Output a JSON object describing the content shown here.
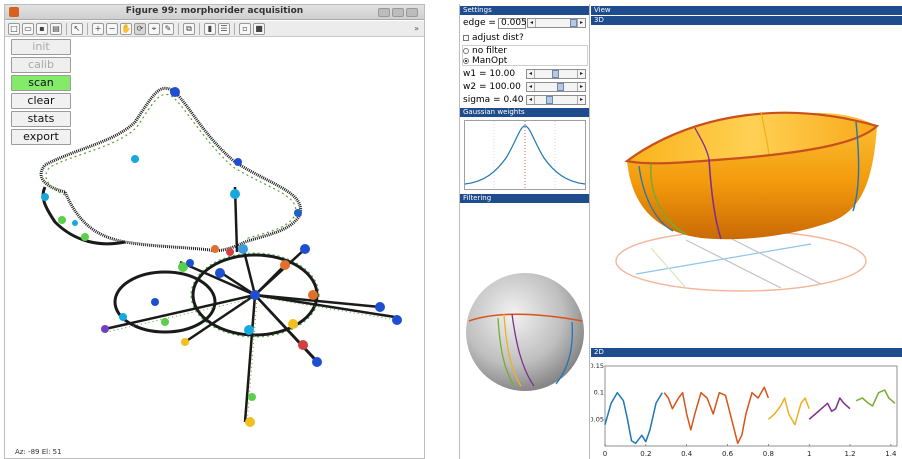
{
  "figure_window": {
    "title": "Figure 99: morphorider acquisition",
    "az_el": "Az: -89 El:  51",
    "buttons": [
      {
        "label": "init",
        "state": "disabled"
      },
      {
        "label": "calib",
        "state": "disabled"
      },
      {
        "label": "scan",
        "state": "active"
      },
      {
        "label": "clear",
        "state": "normal"
      },
      {
        "label": "stats",
        "state": "normal"
      },
      {
        "label": "export",
        "state": "normal"
      }
    ],
    "colors": {
      "scan_active": "#84ea6a",
      "trace": "#1a1a1a"
    }
  },
  "settings": {
    "header": "Settings",
    "edge_label": "edge =",
    "edge_value": "0.005",
    "adjust_dist_label": "adjust dist?",
    "no_filter_label": "no filter",
    "manopt_label": "ManOpt",
    "selected_filter": "ManOpt",
    "w1_label": "w1 = 10.00",
    "w1_level": 0.45,
    "w2_label": "w2 = 100.00",
    "w2_level": 0.6,
    "sigma_label": "sigma = 0.40",
    "sigma_level": 0.3,
    "edge_level": 0.95,
    "gaussian_header": "Gaussian weights",
    "filtering_header": "Filtering"
  },
  "view": {
    "header": "View",
    "view3d_header": "3D",
    "view2d_header": "2D",
    "colors": {
      "bowl": "#f5a311",
      "rim": "#c8501c",
      "bar": "#1f4c8c"
    }
  },
  "chart_data": {
    "type": "line",
    "x_ticks": [
      "0",
      "0.2",
      "0.4",
      "0.6",
      "0.8",
      "1",
      "1.2",
      "1.4"
    ],
    "y_ticks": [
      "0.05",
      "0.1",
      "0.15"
    ],
    "xlim": [
      0,
      1.43
    ],
    "ylim": [
      0,
      0.15
    ],
    "series": [
      {
        "color": "#1f77b4",
        "points": [
          [
            0,
            0.04
          ],
          [
            0.03,
            0.08
          ],
          [
            0.06,
            0.1
          ],
          [
            0.09,
            0.085
          ],
          [
            0.11,
            0.05
          ],
          [
            0.13,
            0.01
          ],
          [
            0.15,
            0.005
          ],
          [
            0.18,
            0.02
          ],
          [
            0.2,
            0.008
          ],
          [
            0.22,
            0.03
          ],
          [
            0.25,
            0.08
          ],
          [
            0.28,
            0.1
          ]
        ]
      },
      {
        "color": "#d95319",
        "points": [
          [
            0.29,
            0.1
          ],
          [
            0.31,
            0.09
          ],
          [
            0.33,
            0.07
          ],
          [
            0.36,
            0.09
          ],
          [
            0.38,
            0.1
          ],
          [
            0.4,
            0.06
          ],
          [
            0.42,
            0.03
          ],
          [
            0.44,
            0.06
          ],
          [
            0.47,
            0.1
          ],
          [
            0.5,
            0.09
          ],
          [
            0.53,
            0.06
          ],
          [
            0.56,
            0.1
          ],
          [
            0.59,
            0.095
          ],
          [
            0.62,
            0.05
          ],
          [
            0.65,
            0.005
          ],
          [
            0.67,
            0.02
          ],
          [
            0.69,
            0.06
          ],
          [
            0.72,
            0.1
          ],
          [
            0.75,
            0.09
          ],
          [
            0.78,
            0.11
          ],
          [
            0.8,
            0.09
          ]
        ]
      },
      {
        "color": "#edb120",
        "points": [
          [
            0.8,
            0.05
          ],
          [
            0.83,
            0.06
          ],
          [
            0.86,
            0.075
          ],
          [
            0.88,
            0.09
          ],
          [
            0.9,
            0.06
          ],
          [
            0.93,
            0.04
          ],
          [
            0.96,
            0.08
          ],
          [
            0.98,
            0.09
          ],
          [
            1.0,
            0.07
          ]
        ]
      },
      {
        "color": "#7e2f8e",
        "points": [
          [
            1.0,
            0.05
          ],
          [
            1.03,
            0.06
          ],
          [
            1.06,
            0.07
          ],
          [
            1.09,
            0.08
          ],
          [
            1.11,
            0.065
          ],
          [
            1.13,
            0.07
          ],
          [
            1.15,
            0.09
          ],
          [
            1.17,
            0.08
          ],
          [
            1.2,
            0.07
          ]
        ]
      },
      {
        "color": "#77ac30",
        "points": [
          [
            1.23,
            0.085
          ],
          [
            1.26,
            0.09
          ],
          [
            1.29,
            0.08
          ],
          [
            1.31,
            0.075
          ],
          [
            1.34,
            0.1
          ],
          [
            1.37,
            0.105
          ],
          [
            1.39,
            0.09
          ],
          [
            1.42,
            0.08
          ]
        ]
      }
    ]
  }
}
